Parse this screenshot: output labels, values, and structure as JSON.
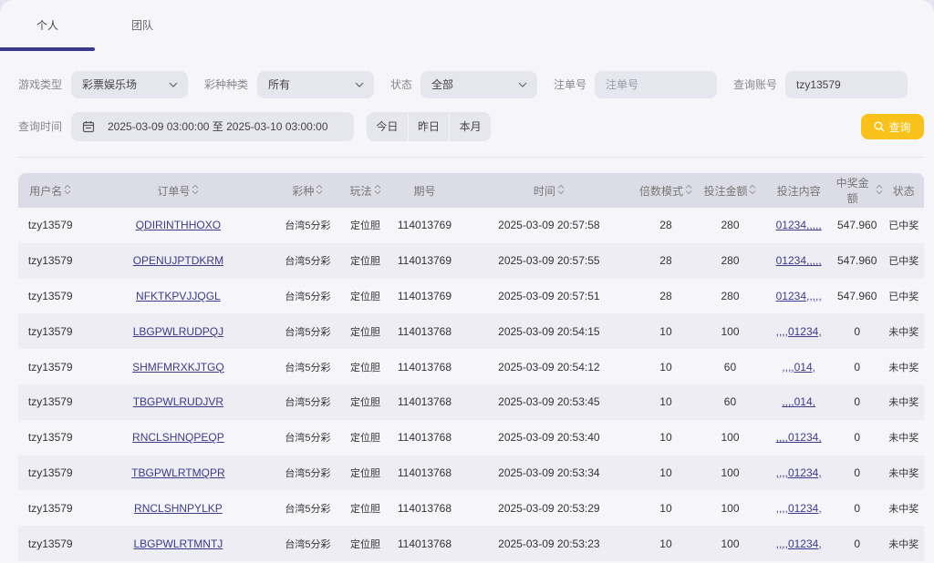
{
  "tabs": [
    {
      "label": "个人"
    },
    {
      "label": "团队"
    }
  ],
  "filters": {
    "game_type": {
      "label": "游戏类型",
      "value": "彩票娱乐场"
    },
    "lottery_type": {
      "label": "彩种种类",
      "value": "所有"
    },
    "status": {
      "label": "状态",
      "value": "全部"
    },
    "order_no": {
      "label": "注单号",
      "placeholder": "注单号"
    },
    "account": {
      "label": "查询账号",
      "value": "tzy13579"
    },
    "time": {
      "label": "查询时间",
      "value": "2025-03-09 03:00:00 至 2025-03-10 03:00:00"
    },
    "quick": [
      "今日",
      "昨日",
      "本月"
    ],
    "search_label": "查询"
  },
  "table": {
    "headers": [
      "用户名",
      "订单号",
      "彩种",
      "玩法",
      "期号",
      "时间",
      "倍数模式",
      "投注金额",
      "投注内容",
      "中奖金额",
      "状态"
    ],
    "rows": [
      [
        "tzy13579",
        "QDIRINTHHOXO",
        "台湾5分彩",
        "定位胆",
        "114013769",
        "2025-03-09 20:57:58",
        "28",
        "280",
        "01234,,,,,",
        "547.960",
        "已中奖"
      ],
      [
        "tzy13579",
        "OPENUJPTDKRM",
        "台湾5分彩",
        "定位胆",
        "114013769",
        "2025-03-09 20:57:55",
        "28",
        "280",
        "01234,,,,,",
        "547.960",
        "已中奖"
      ],
      [
        "tzy13579",
        "NFKTKPVJJQGL",
        "台湾5分彩",
        "定位胆",
        "114013769",
        "2025-03-09 20:57:51",
        "28",
        "280",
        "01234,,,,,",
        "547.960",
        "已中奖"
      ],
      [
        "tzy13579",
        "LBGPWLRUDPQJ",
        "台湾5分彩",
        "定位胆",
        "114013768",
        "2025-03-09 20:54:15",
        "10",
        "100",
        ",,,,01234,",
        "0",
        "未中奖"
      ],
      [
        "tzy13579",
        "SHMFMRXKJTGQ",
        "台湾5分彩",
        "定位胆",
        "114013768",
        "2025-03-09 20:54:12",
        "10",
        "60",
        ",,,,014,",
        "0",
        "未中奖"
      ],
      [
        "tzy13579",
        "TBGPWLRUDJVR",
        "台湾5分彩",
        "定位胆",
        "114013768",
        "2025-03-09 20:53:45",
        "10",
        "60",
        ",,,,014,",
        "0",
        "未中奖"
      ],
      [
        "tzy13579",
        "RNCLSHNQPEQP",
        "台湾5分彩",
        "定位胆",
        "114013768",
        "2025-03-09 20:53:40",
        "10",
        "100",
        ",,,,01234,",
        "0",
        "未中奖"
      ],
      [
        "tzy13579",
        "TBGPWLRTMQPR",
        "台湾5分彩",
        "定位胆",
        "114013768",
        "2025-03-09 20:53:34",
        "10",
        "100",
        ",,,,01234,",
        "0",
        "未中奖"
      ],
      [
        "tzy13579",
        "RNCLSHNPYLKP",
        "台湾5分彩",
        "定位胆",
        "114013768",
        "2025-03-09 20:53:29",
        "10",
        "100",
        ",,,,01234,",
        "0",
        "未中奖"
      ],
      [
        "tzy13579",
        "LBGPWLRTMNTJ",
        "台湾5分彩",
        "定位胆",
        "114013768",
        "2025-03-09 20:53:23",
        "10",
        "100",
        ",,,,01234,",
        "0",
        "未中奖"
      ]
    ]
  },
  "colors": {
    "accent": "#3d3a8c",
    "search_button": "#f8c21a"
  }
}
